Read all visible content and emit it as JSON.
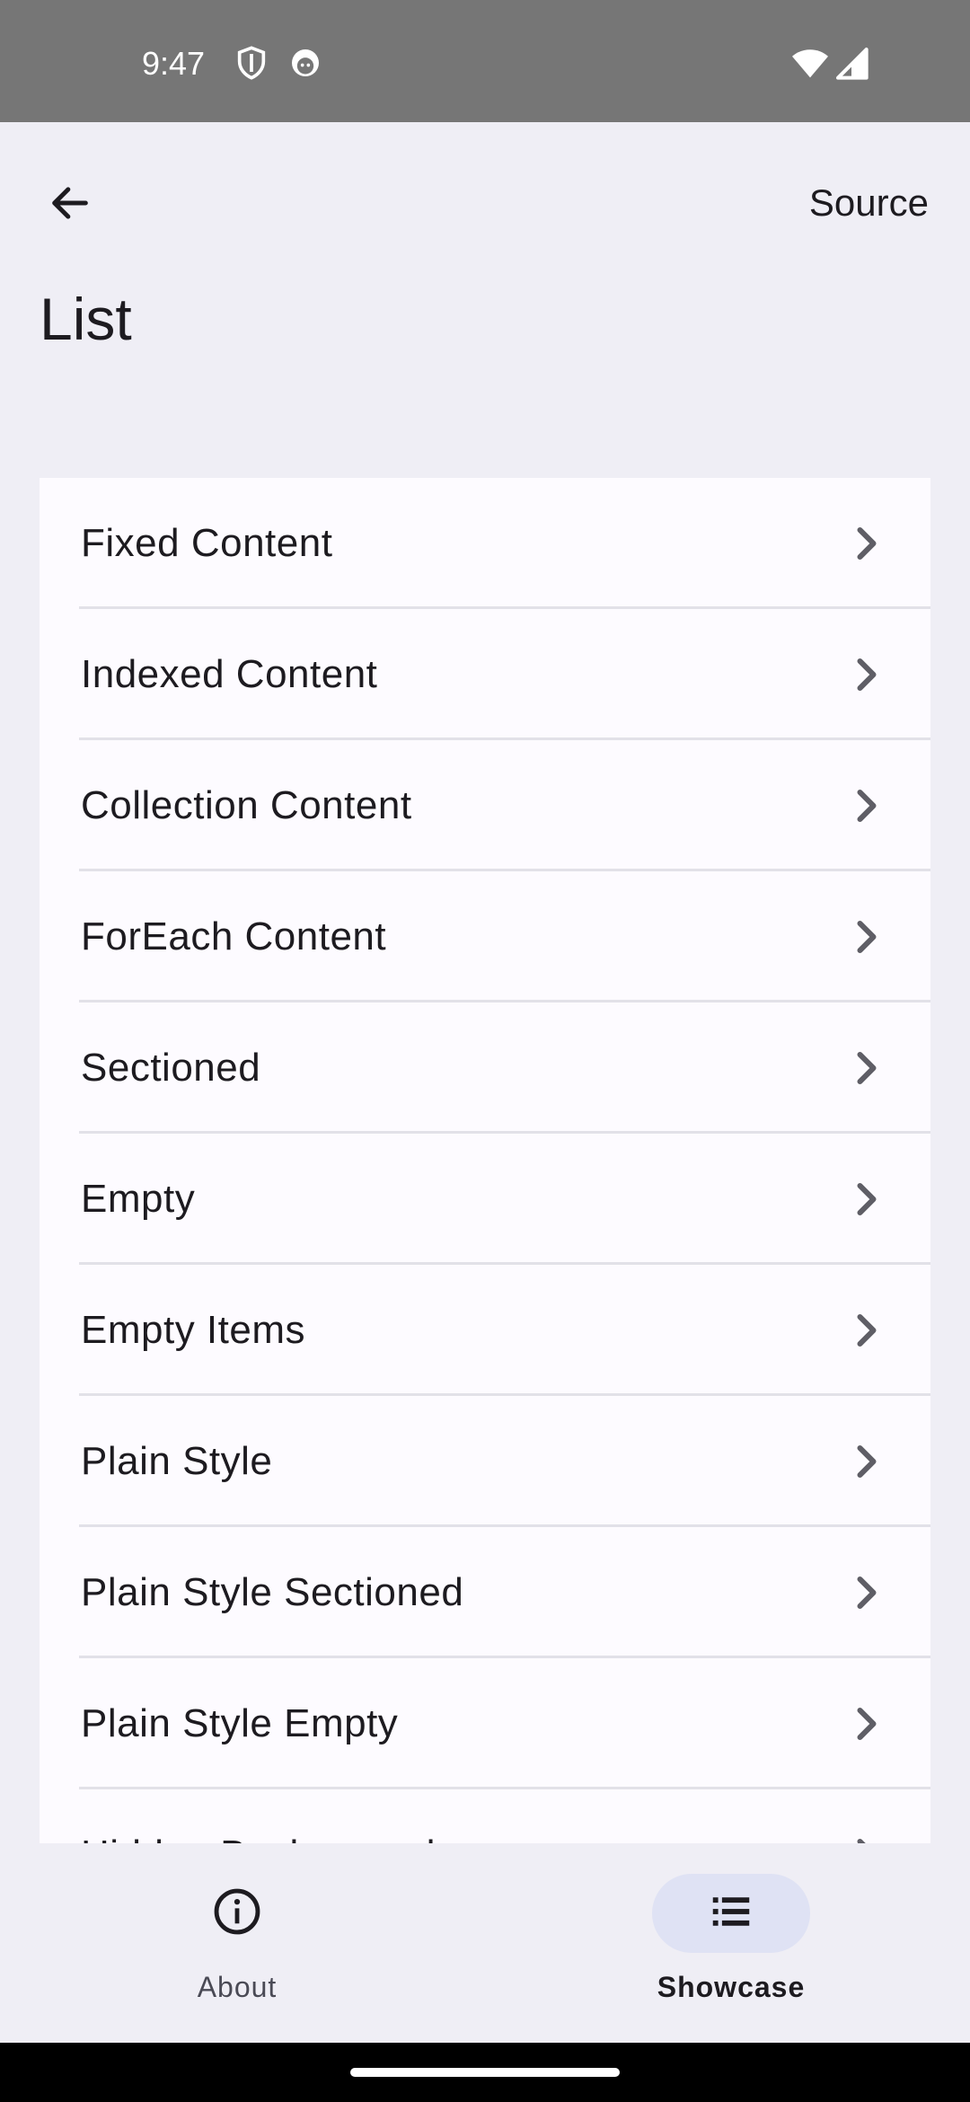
{
  "status_bar": {
    "time": "9:47",
    "icons": [
      "shield-icon",
      "face-icon",
      "wifi-icon",
      "cell-signal-icon"
    ]
  },
  "app_bar": {
    "back_icon": "arrow-left-icon",
    "source_label": "Source"
  },
  "page": {
    "title": "List"
  },
  "list": {
    "items": [
      {
        "label": "Fixed Content"
      },
      {
        "label": "Indexed Content"
      },
      {
        "label": "Collection Content"
      },
      {
        "label": "ForEach Content"
      },
      {
        "label": "Sectioned"
      },
      {
        "label": "Empty"
      },
      {
        "label": "Empty Items"
      },
      {
        "label": "Plain Style"
      },
      {
        "label": "Plain Style Sectioned"
      },
      {
        "label": "Plain Style Empty"
      },
      {
        "label": "Hidden Background"
      }
    ]
  },
  "bottom_nav": {
    "about_label": "About",
    "showcase_label": "Showcase",
    "selected": "Showcase"
  },
  "colors": {
    "background": "#efeef5",
    "card": "#fdfbff",
    "status_bar": "#767676",
    "nav_indicator": "#dfe2f4",
    "text": "#1d1b20"
  }
}
